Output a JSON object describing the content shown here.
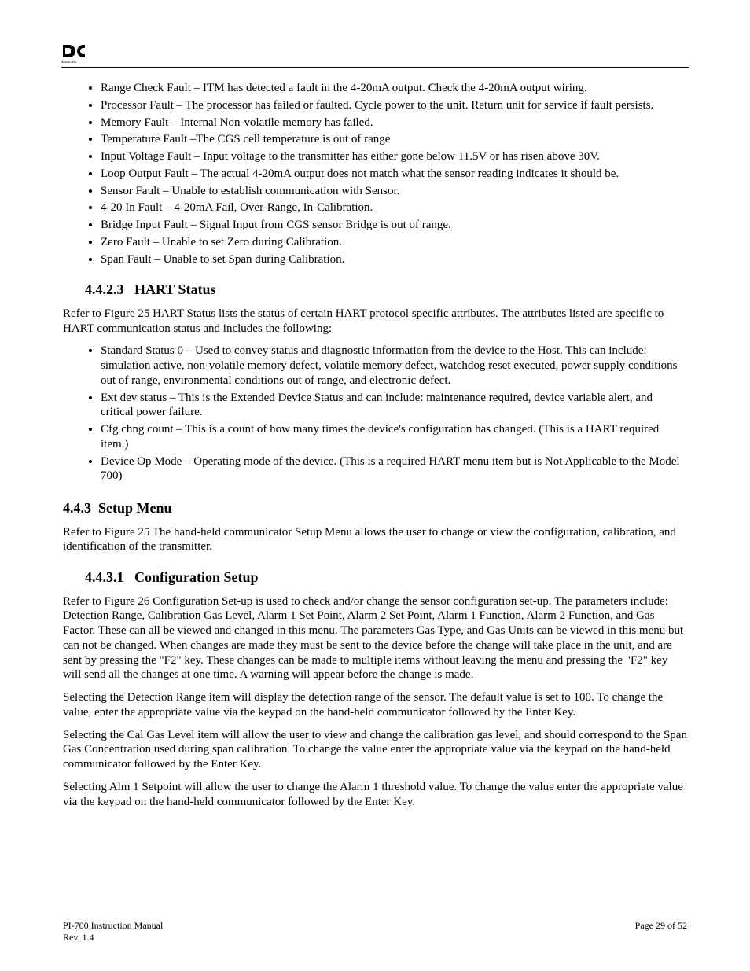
{
  "logo": {
    "caption": "detcon inc."
  },
  "bullets_top": [
    "Range Check Fault – ITM has detected a fault in the 4-20mA output. Check the 4-20mA output wiring.",
    "Processor Fault – The processor has failed or faulted. Cycle power to the unit. Return unit for service if fault persists.",
    "Memory Fault – Internal Non-volatile memory has failed.",
    "Temperature Fault –The CGS cell temperature is out of range",
    "Input Voltage Fault – Input voltage to the transmitter has either gone below 11.5V or has risen above 30V.",
    "Loop Output Fault – The actual 4-20mA output does not match what the sensor reading indicates it should be.",
    "Sensor Fault – Unable to establish communication with Sensor.",
    "4-20 In Fault – 4-20mA Fail, Over-Range, In-Calibration.",
    "Bridge Input Fault – Signal Input from CGS sensor Bridge is out of range.",
    "Zero Fault – Unable to set Zero during Calibration.",
    "Span Fault – Unable to set Span during Calibration."
  ],
  "hart_status": {
    "heading_num": "4.4.2.3",
    "heading_text": "HART Status",
    "intro": "Refer to Figure 25 HART Status lists the status of certain HART protocol specific attributes. The attributes listed are specific to HART communication status and includes the following:",
    "items": [
      "Standard Status 0 – Used to convey status and diagnostic information from the device to the Host. This can include: simulation active, non-volatile memory defect, volatile memory defect, watchdog reset executed, power supply conditions out of range, environmental conditions out of range, and electronic defect.",
      "Ext dev status – This is the Extended Device Status and can include: maintenance required, device variable alert, and critical power failure.",
      "Cfg chng count – This is a count of how many times the device's configuration has changed. (This is a HART required item.)",
      "Device Op Mode – Operating mode of the device. (This is a required HART menu item but is Not Applicable to the Model 700)"
    ]
  },
  "setup_menu": {
    "heading_num": "4.4.3",
    "heading_text": "Setup Menu",
    "intro": "Refer to Figure 25 The hand-held communicator Setup Menu allows the user to change or view the configuration, calibration, and identification of the transmitter.",
    "config_setup": {
      "heading_num": "4.4.3.1",
      "heading_text": "Configuration Setup",
      "para1": "Refer to Figure 26 Configuration Set-up is used to check and/or change the sensor configuration set-up. The parameters include: Detection Range, Calibration Gas Level, Alarm 1 Set Point, Alarm 2 Set Point, Alarm 1 Function, Alarm 2 Function, and Gas Factor. These can all be viewed and changed in this menu. The parameters Gas Type, and Gas Units can be viewed in this menu but can not be changed. When changes are made they must be sent to the device before the change will take place in the unit, and are sent by pressing the \"F2\" key. These changes can be made to multiple items without leaving the menu and pressing the \"F2\" key will send all the changes at one time. A warning will appear before the change is made.",
      "para2": "Selecting the Detection Range item will display the detection range of the sensor. The default value is set to 100. To change the value, enter the appropriate value via the keypad on the hand-held communicator followed by the Enter Key.",
      "para3": "Selecting the Cal Gas Level item will allow the user to view and change the calibration gas level, and should correspond to the Span Gas Concentration used during span calibration. To change the value enter the appropriate value via the keypad on the hand-held communicator followed by the Enter Key.",
      "para4": "Selecting Alm 1 Setpoint will allow the user to change the Alarm 1 threshold value. To change the value enter the appropriate value via the keypad on the hand-held communicator followed by the Enter Key."
    }
  },
  "footer": {
    "left1": "PI-700 Instruction Manual",
    "left2": "Rev. 1.4",
    "right1": "Page 29 of 52"
  }
}
